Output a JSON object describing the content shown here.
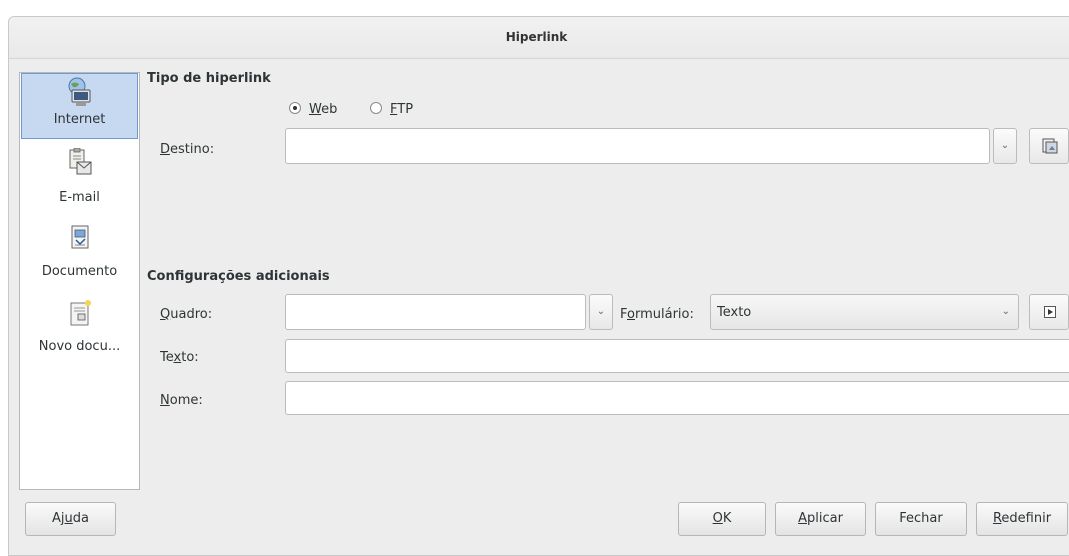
{
  "window": {
    "title": "Hiperlink"
  },
  "sidebar": {
    "items": [
      {
        "label": "Internet",
        "icon": "internet-icon",
        "selected": true
      },
      {
        "label": "E-mail",
        "icon": "email-icon",
        "selected": false
      },
      {
        "label": "Documento",
        "icon": "document-icon",
        "selected": false
      },
      {
        "label": "Novo docu...",
        "icon": "new-document-icon",
        "selected": false
      }
    ]
  },
  "hyperlink_type": {
    "section_title": "Tipo de hiperlink",
    "radio_web": {
      "accel": "W",
      "rest": "eb",
      "checked": true
    },
    "radio_ftp": {
      "accel": "F",
      "rest": "TP",
      "checked": false
    },
    "destino": {
      "accel": "D",
      "rest": "estino:",
      "value": ""
    }
  },
  "additional": {
    "section_title": "Configurações adicionais",
    "quadro": {
      "accel": "Q",
      "rest": "uadro:",
      "value": ""
    },
    "formulario": {
      "pre": "F",
      "accel": "o",
      "rest": "rmulário:",
      "value": "Texto"
    },
    "texto": {
      "pre": "Te",
      "accel": "x",
      "rest": "to:",
      "value": ""
    },
    "nome": {
      "accel": "N",
      "rest": "ome:",
      "value": ""
    }
  },
  "buttons": {
    "help": {
      "pre": "Aj",
      "accel": "u",
      "rest": "da"
    },
    "ok": {
      "accel": "O",
      "rest": "K"
    },
    "apply": {
      "accel": "A",
      "rest": "plicar"
    },
    "close": {
      "label": "Fechar"
    },
    "reset": {
      "accel": "R",
      "rest": "edefinir"
    }
  }
}
